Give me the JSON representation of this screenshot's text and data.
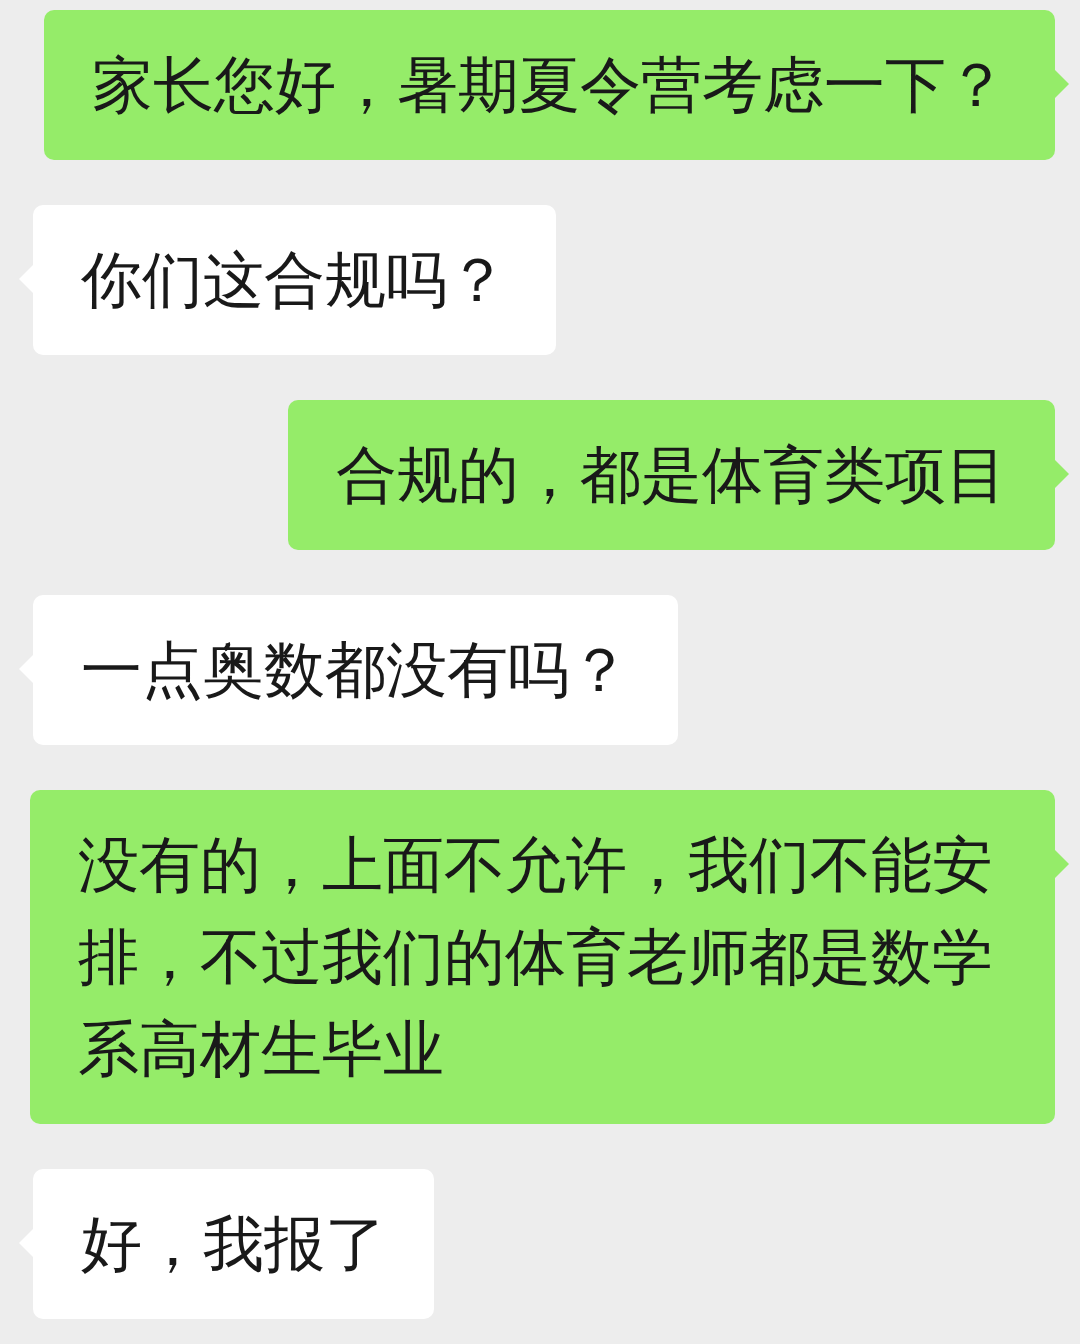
{
  "messages": [
    {
      "kind": "outgoing",
      "text": "家长您好，暑期夏令营考虑一下？"
    },
    {
      "kind": "incoming",
      "text": "你们这合规吗？"
    },
    {
      "kind": "outgoing",
      "text": "合规的，都是体育类项目"
    },
    {
      "kind": "incoming",
      "text": "一点奥数都没有吗？"
    },
    {
      "kind": "outgoing",
      "text": "没有的，上面不允许，我们不能安排，不过我们的体育老师都是数学系高材生毕业"
    },
    {
      "kind": "incoming",
      "text": "好，我报了"
    }
  ]
}
